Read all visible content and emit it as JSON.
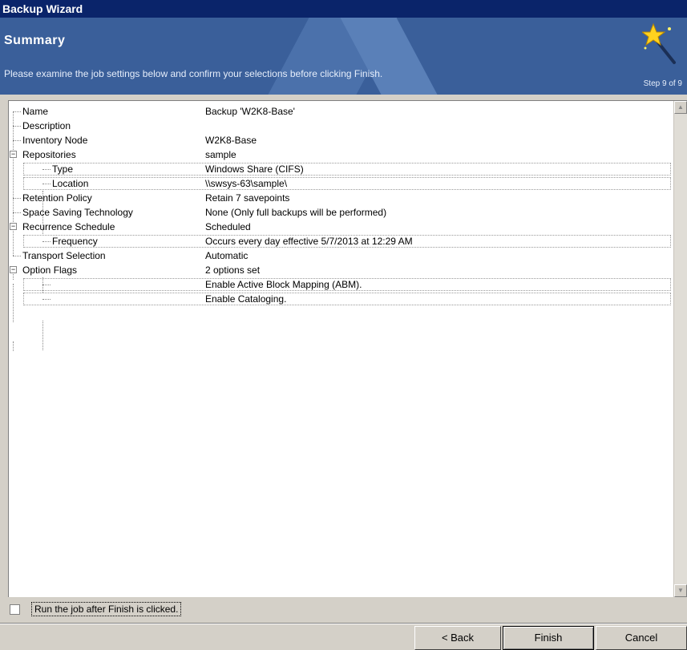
{
  "window": {
    "title": "Backup Wizard"
  },
  "header": {
    "title": "Summary",
    "subtitle": "Please examine the job settings below and confirm your selections before clicking Finish.",
    "step": "Step 9 of 9",
    "icon": "magic-wand-icon"
  },
  "tree": [
    {
      "label": "Name",
      "value": "Backup 'W2K8-Base'"
    },
    {
      "label": "Description",
      "value": ""
    },
    {
      "label": "Inventory Node",
      "value": "W2K8-Base"
    },
    {
      "label": "Repositories",
      "value": "sample"
    },
    {
      "label": "Type",
      "value": "Windows Share (CIFS)"
    },
    {
      "label": "Location",
      "value": "\\\\swsys-63\\sample\\"
    },
    {
      "label": "Retention Policy",
      "value": "Retain 7 savepoints"
    },
    {
      "label": "Space Saving Technology",
      "value": "None (Only full backups will be performed)"
    },
    {
      "label": "Recurrence Schedule",
      "value": "Scheduled"
    },
    {
      "label": "Frequency",
      "value": "Occurs every day  effective 5/7/2013 at 12:29 AM"
    },
    {
      "label": "Transport Selection",
      "value": "Automatic"
    },
    {
      "label": "Option Flags",
      "value": "2 options set"
    },
    {
      "label": "",
      "value": "Enable Active Block Mapping (ABM)."
    },
    {
      "label": "",
      "value": "Enable Cataloging."
    }
  ],
  "expander_symbol": "−",
  "checkbox": {
    "label": "Run the job after Finish is clicked.",
    "checked": false
  },
  "buttons": {
    "back": "< Back",
    "finish": "Finish",
    "cancel": "Cancel"
  },
  "colors": {
    "titlebar": "#0a246a",
    "header": "#3a5f9a",
    "dialog": "#d4d0c8"
  }
}
